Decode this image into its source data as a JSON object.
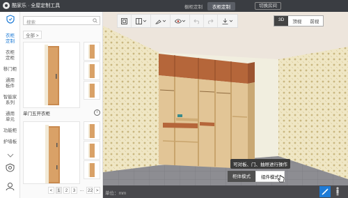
{
  "app": {
    "title": "酷家乐 · 全屋定制工具",
    "tabs": [
      "橱柜定制",
      "衣柜定制"
    ],
    "active_tab": 1,
    "switch_label": "切换房间"
  },
  "rail": {
    "items": [
      {
        "label": "",
        "icon": "shield-icon"
      },
      {
        "label": "衣柜\n定制",
        "icon": ""
      },
      {
        "label": "衣柜\n定柜",
        "icon": ""
      },
      {
        "label": "移门柜",
        "icon": ""
      },
      {
        "label": "通用\n板件",
        "icon": ""
      },
      {
        "label": "智能家\n系列",
        "icon": ""
      },
      {
        "label": "通用\n单元",
        "icon": ""
      },
      {
        "label": "功能柜",
        "icon": ""
      },
      {
        "label": "护墙板",
        "icon": ""
      }
    ],
    "bottom_icons": [
      "settings-shield-icon",
      "user-icon"
    ]
  },
  "panel": {
    "search_placeholder": "搜索",
    "breadcrumb": "全部 >",
    "product_caption": "单门五开衣柜",
    "info": "i",
    "pager": [
      "<",
      "1",
      "2",
      "3",
      "...",
      "22",
      ">",
      "跳至"
    ]
  },
  "toolbar": {
    "icons": [
      "layout-icon",
      "cabinet-icon",
      "paint-icon",
      "eye-icon",
      "undo-icon",
      "redo-icon",
      "download-icon"
    ],
    "view_modes": [
      "3D",
      "顶视",
      "前视"
    ],
    "active_view": 0
  },
  "viewport": {
    "tooltip": "可对板、门、抽屉进行操作",
    "modes": [
      "柜体模式",
      "组件模式"
    ],
    "active_mode": 1
  },
  "statusbar": {
    "unit": "单位：mm"
  },
  "colors": {
    "accent": "#1e7bd6",
    "topbar": "#3a3d42",
    "cabinet_wood": "#e2c596",
    "cabinet_top": "#b5663a"
  }
}
